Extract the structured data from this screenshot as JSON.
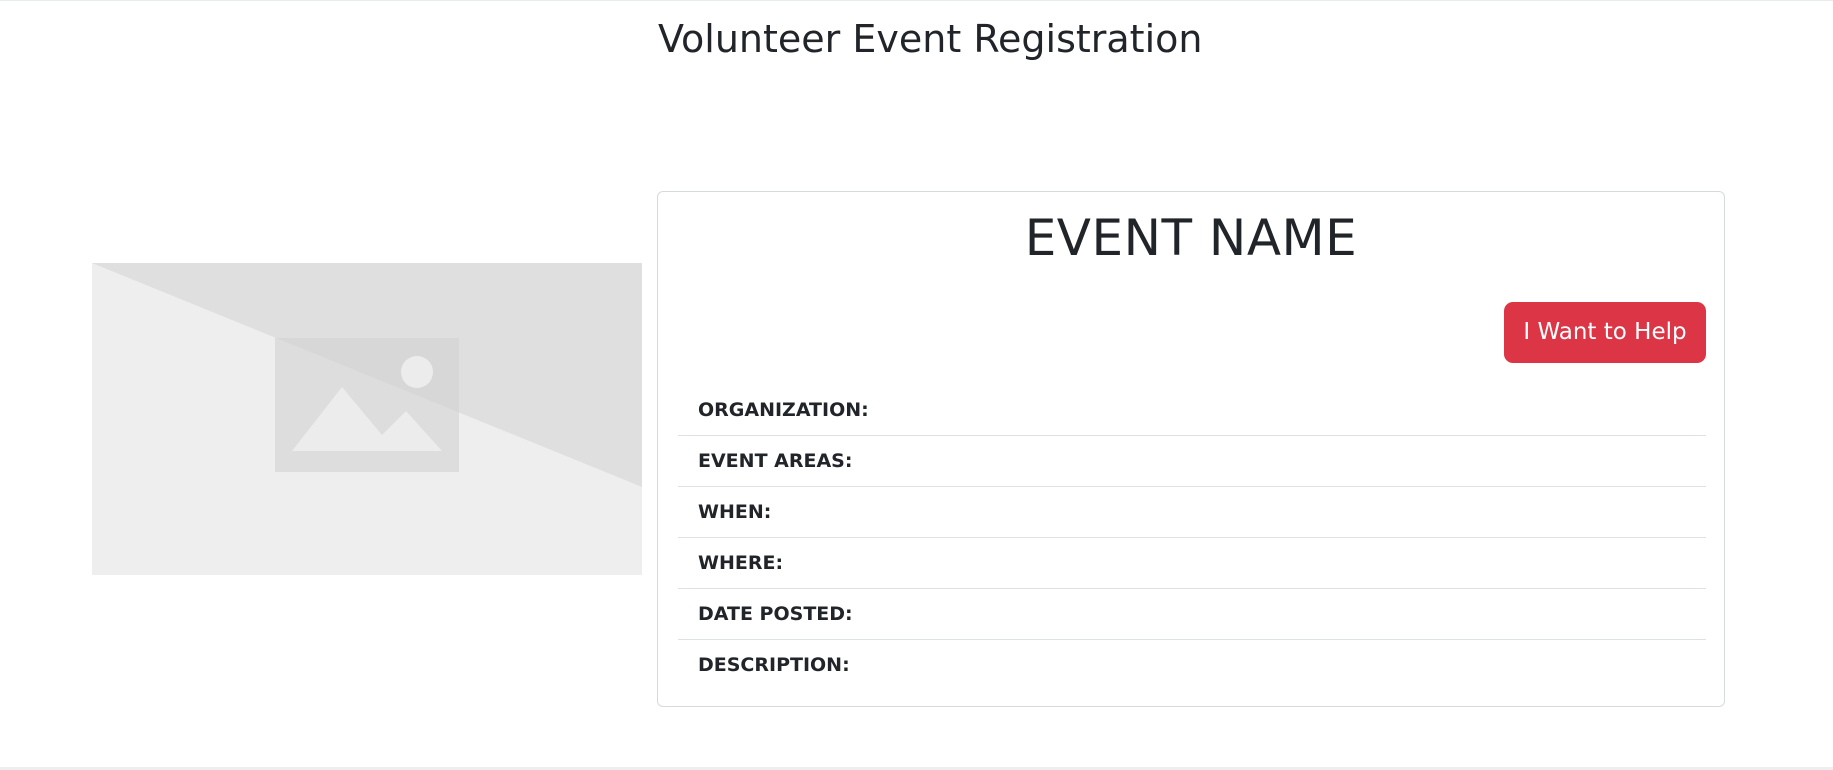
{
  "page": {
    "title": "Volunteer Event Registration"
  },
  "image": {
    "icon": "image-placeholder-icon",
    "colors": {
      "light": "#eeeeee",
      "dark": "#dfdfdf",
      "frame": "#cfcfcf",
      "glyph": "#ececec"
    }
  },
  "event": {
    "name": "EVENT NAME",
    "help_button_label": "I Want to Help",
    "details": [
      {
        "label": "ORGANIZATION:"
      },
      {
        "label": "EVENT AREAS:"
      },
      {
        "label": "WHEN:"
      },
      {
        "label": "WHERE:"
      },
      {
        "label": "DATE POSTED:"
      },
      {
        "label": "DESCRIPTION:"
      }
    ]
  },
  "colors": {
    "accent": "#dc3545",
    "text": "#212529",
    "border": "#dee2e6"
  }
}
